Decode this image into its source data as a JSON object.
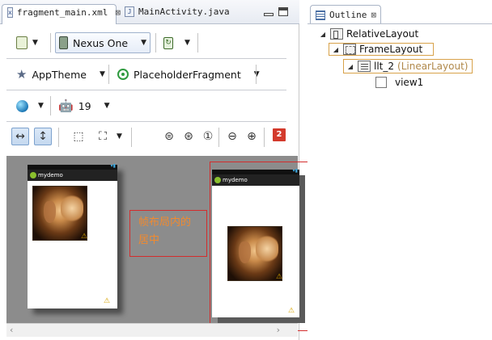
{
  "editor": {
    "tabs": [
      {
        "label": "fragment_main.xml",
        "active": true,
        "close": "⊠"
      },
      {
        "label": "MainActivity.java",
        "active": false,
        "close": "⊠"
      }
    ],
    "toolbar": {
      "device_label": "Nexus One",
      "theme_label": "AppTheme",
      "activity_label": "PlaceholderFragment",
      "api_level": "19",
      "error_count": "2"
    },
    "preview": {
      "app_title_left": "mydemo",
      "app_title_right": "mydemo",
      "annotation_line1": "帧布局内的",
      "annotation_line2": "居中"
    }
  },
  "outline": {
    "tab_label": "Outline",
    "tab_close": "⊠",
    "tree": [
      {
        "label": "RelativeLayout",
        "suffix": ""
      },
      {
        "label": "FrameLayout",
        "suffix": ""
      },
      {
        "label": "llt_2",
        "suffix": "(LinearLayout)"
      },
      {
        "label": "view1",
        "suffix": ""
      }
    ]
  },
  "colors": {
    "annotation_border": "#d32d2d",
    "annotation_text": "#f08a30",
    "highlight_border": "#d8a24a",
    "error_badge": "#d33a2c"
  },
  "icons": {
    "android": "android-icon",
    "theme": "star-icon",
    "activity": "activity-icon",
    "globe": "globe-icon"
  }
}
